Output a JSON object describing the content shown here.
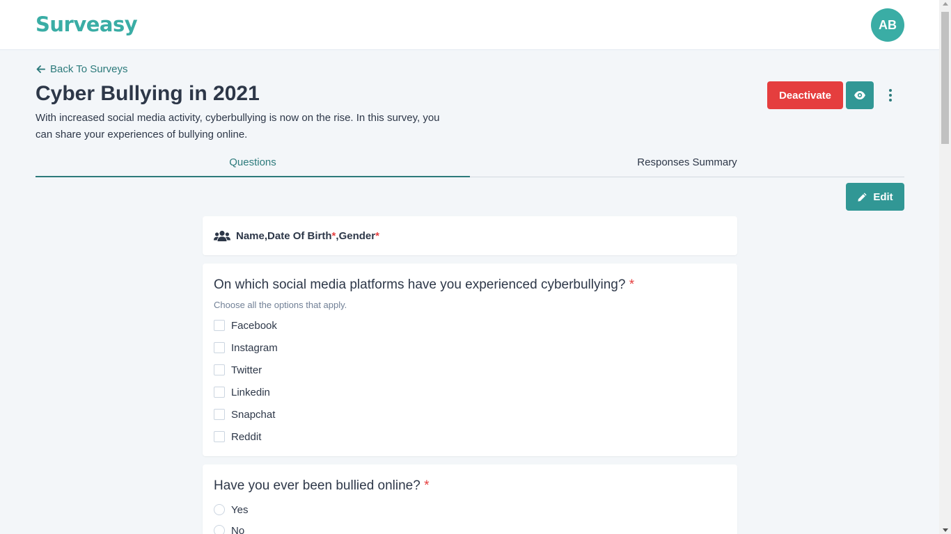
{
  "app": {
    "logo": "Surveasy",
    "avatar_initials": "AB"
  },
  "nav": {
    "back_label": "Back To Surveys"
  },
  "survey": {
    "title": "Cyber Bullying in 2021",
    "description": "With increased social media activity, cyberbullying is now on the rise. In this survey, you can share your experiences of bullying online."
  },
  "actions": {
    "deactivate_label": "Deactivate",
    "edit_label": "Edit",
    "eye_icon": "eye-icon",
    "more_icon": "more-vertical-icon"
  },
  "tabs": [
    {
      "label": "Questions",
      "active": true
    },
    {
      "label": "Responses Summary",
      "active": false
    }
  ],
  "demographics": {
    "icon": "users-icon",
    "fields": [
      {
        "label": "Name",
        "required": false
      },
      {
        "label": "Date Of Birth",
        "required": true
      },
      {
        "label": "Gender",
        "required": true
      }
    ]
  },
  "questions": [
    {
      "title": "On which social media platforms have you experienced cyberbullying?",
      "required": true,
      "hint": "Choose all the options that apply.",
      "type": "checkbox",
      "options": [
        "Facebook",
        "Instagram",
        "Twitter",
        "Linkedin",
        "Snapchat",
        "Reddit"
      ]
    },
    {
      "title": "Have you ever been bullied online?",
      "required": true,
      "type": "radio",
      "options": [
        "Yes",
        "No"
      ]
    }
  ],
  "colors": {
    "brand": "#3aada5",
    "accent": "#319795",
    "danger": "#e53e3e",
    "background": "#f3f6f9"
  }
}
